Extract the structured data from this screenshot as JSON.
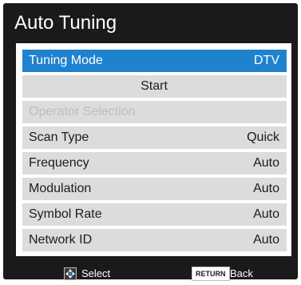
{
  "screen": {
    "title": "Auto Tuning"
  },
  "menu": {
    "items": [
      {
        "label": "Tuning Mode",
        "value": "DTV",
        "state": "selected"
      },
      {
        "label": "Start",
        "value": "",
        "state": "normal"
      },
      {
        "label": "Operator Selection",
        "value": "",
        "state": "disabled"
      },
      {
        "label": "Scan Type",
        "value": "Quick",
        "state": "normal"
      },
      {
        "label": "Frequency",
        "value": "Auto",
        "state": "normal"
      },
      {
        "label": "Modulation",
        "value": "Auto",
        "state": "normal"
      },
      {
        "label": "Symbol Rate",
        "value": "Auto",
        "state": "normal"
      },
      {
        "label": "Network ID",
        "value": "Auto",
        "state": "normal"
      }
    ]
  },
  "footer": {
    "select_label": "Select",
    "return_key": "RETURN",
    "back_label": "Back"
  },
  "colors": {
    "background": "#1a1a1a",
    "selected": "#1f82cf",
    "row": "#dcdcdc",
    "disabled_text": "#bdbdbd"
  },
  "icons": {
    "select": "dpad-icon",
    "back": "return-key-icon"
  }
}
